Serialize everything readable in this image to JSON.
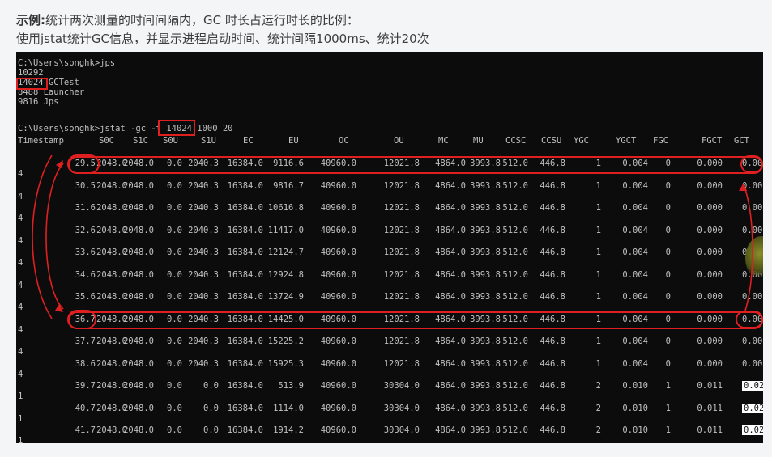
{
  "caption": {
    "prefix": "示例:",
    "line1": "统计两次测量的时间间隔内，GC 时长占运行时长的比例：",
    "line2": "使用jstat统计GC信息，并显示进程启动时间、统计间隔1000ms、统计20次"
  },
  "terminal": {
    "lines": [
      "C:\\Users\\songhk>jps",
      "10292",
      "14024 GCTest",
      "8488 Launcher",
      "9816 Jps",
      "",
      "C:\\Users\\songhk>jstat -gc -t 14024 1000 20"
    ],
    "headers": [
      "Timestamp",
      "S0C",
      "S1C",
      "S0U",
      "S1U",
      "EC",
      "EU",
      "OC",
      "OU",
      "MC",
      "MU",
      "CCSC",
      "CCSU",
      "YGC",
      "YGCT",
      "FGC",
      "FGCT",
      "GCT"
    ],
    "timestamps": [
      "4",
      "4",
      "4",
      "4",
      "4",
      "4",
      "4",
      "4",
      "4",
      "4",
      "1",
      "1",
      "1"
    ],
    "rows": [
      [
        "29.5",
        "2048.0",
        "2048.0",
        "0.0",
        "2040.3",
        "16384.0",
        "9116.6",
        "40960.0",
        "12021.8",
        "4864.0",
        "3993.8",
        "512.0",
        "446.8",
        "1",
        "0.004",
        "0",
        "0.000",
        "0.00"
      ],
      [
        "30.5",
        "2048.0",
        "2048.0",
        "0.0",
        "2040.3",
        "16384.0",
        "9816.7",
        "40960.0",
        "12021.8",
        "4864.0",
        "3993.8",
        "512.0",
        "446.8",
        "1",
        "0.004",
        "0",
        "0.000",
        "0.00"
      ],
      [
        "31.6",
        "2048.0",
        "2048.0",
        "0.0",
        "2040.3",
        "16384.0",
        "10616.8",
        "40960.0",
        "12021.8",
        "4864.0",
        "3993.8",
        "512.0",
        "446.8",
        "1",
        "0.004",
        "0",
        "0.000",
        "0.00"
      ],
      [
        "32.6",
        "2048.0",
        "2048.0",
        "0.0",
        "2040.3",
        "16384.0",
        "11417.0",
        "40960.0",
        "12021.8",
        "4864.0",
        "3993.8",
        "512.0",
        "446.8",
        "1",
        "0.004",
        "0",
        "0.000",
        "0.00"
      ],
      [
        "33.6",
        "2048.0",
        "2048.0",
        "0.0",
        "2040.3",
        "16384.0",
        "12124.7",
        "40960.0",
        "12021.8",
        "4864.0",
        "3993.8",
        "512.0",
        "446.8",
        "1",
        "0.004",
        "0",
        "0.000",
        "0.00"
      ],
      [
        "34.6",
        "2048.0",
        "2048.0",
        "0.0",
        "2040.3",
        "16384.0",
        "12924.8",
        "40960.0",
        "12021.8",
        "4864.0",
        "3993.8",
        "512.0",
        "446.8",
        "1",
        "0.004",
        "0",
        "0.000",
        "0.00"
      ],
      [
        "35.6",
        "2048.0",
        "2048.0",
        "0.0",
        "2040.3",
        "16384.0",
        "13724.9",
        "40960.0",
        "12021.8",
        "4864.0",
        "3993.8",
        "512.0",
        "446.8",
        "1",
        "0.004",
        "0",
        "0.000",
        "0.00"
      ],
      [
        "36.7",
        "2048.0",
        "2048.0",
        "0.0",
        "2040.3",
        "16384.0",
        "14425.0",
        "40960.0",
        "12021.8",
        "4864.0",
        "3993.8",
        "512.0",
        "446.8",
        "1",
        "0.004",
        "0",
        "0.000",
        "0.00"
      ],
      [
        "37.7",
        "2048.0",
        "2048.0",
        "0.0",
        "2040.3",
        "16384.0",
        "15225.2",
        "40960.0",
        "12021.8",
        "4864.0",
        "3993.8",
        "512.0",
        "446.8",
        "1",
        "0.004",
        "0",
        "0.000",
        "0.00"
      ],
      [
        "38.6",
        "2048.0",
        "2048.0",
        "0.0",
        "2040.3",
        "16384.0",
        "15925.3",
        "40960.0",
        "12021.8",
        "4864.0",
        "3993.8",
        "512.0",
        "446.8",
        "1",
        "0.004",
        "0",
        "0.000",
        "0.00"
      ],
      [
        "39.7",
        "2048.0",
        "2048.0",
        "0.0",
        "0.0",
        "16384.0",
        "513.9",
        "40960.0",
        "30304.0",
        "4864.0",
        "3993.8",
        "512.0",
        "446.8",
        "2",
        "0.010",
        "1",
        "0.011",
        "0.02"
      ],
      [
        "40.7",
        "2048.0",
        "2048.0",
        "0.0",
        "0.0",
        "16384.0",
        "1114.0",
        "40960.0",
        "30304.0",
        "4864.0",
        "3993.8",
        "512.0",
        "446.8",
        "2",
        "0.010",
        "1",
        "0.011",
        "0.02"
      ],
      [
        "41.7",
        "2048.0",
        "2048.0",
        "0.0",
        "0.0",
        "16384.0",
        "1914.2",
        "40960.0",
        "30304.0",
        "4864.0",
        "3993.8",
        "512.0",
        "446.8",
        "2",
        "0.010",
        "1",
        "0.011",
        "0.02"
      ]
    ]
  },
  "colors": {
    "annotation": "#e02020",
    "terminal_bg": "#0c0c0c",
    "terminal_fg": "#c0c0c0"
  }
}
